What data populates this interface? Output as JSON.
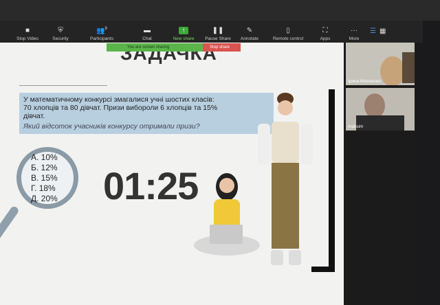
{
  "toolbar": {
    "items": [
      {
        "label": "Stop Video",
        "icon": "video-icon"
      },
      {
        "label": "Security",
        "icon": "shield-icon"
      },
      {
        "label": "Participants",
        "icon": "participants-icon",
        "count": "9"
      },
      {
        "label": "Chat",
        "icon": "chat-icon"
      },
      {
        "label": "New share",
        "icon": "share-icon"
      },
      {
        "label": "Pause Share",
        "icon": "pause-icon"
      },
      {
        "label": "Annotate",
        "icon": "pencil-icon"
      },
      {
        "label": "Remote control",
        "icon": "mouse-icon"
      },
      {
        "label": "Apps",
        "icon": "apps-icon"
      },
      {
        "label": "More",
        "icon": "more-icon"
      }
    ]
  },
  "sharing": {
    "status": "You are screen sharing",
    "stop": "Stop share"
  },
  "slide": {
    "title": "ЗАДАЧКА",
    "problem_line1": "У математичному конкурсі змагалися учні шостих класів:",
    "problem_line2": "70 хлопців та 80 дівчат. Призи вибороли 6 хлопців та 15%",
    "problem_line3": "дівчат.",
    "question": "Який відсоток учасників конкурсу отримали призи?",
    "answers": [
      "А. 10%",
      "Б. 12%",
      "В. 15%",
      "Г. 18%",
      "Д. 20%"
    ],
    "timer": "01:25"
  },
  "participants": [
    {
      "name": "Ірина Матвієнко"
    },
    {
      "name": "maksim"
    }
  ]
}
